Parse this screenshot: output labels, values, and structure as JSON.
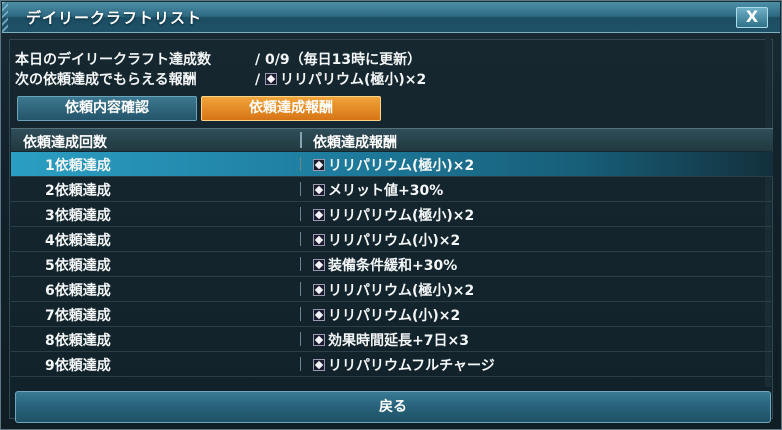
{
  "window": {
    "title": "デイリークラフトリスト",
    "close_label": "X"
  },
  "info": {
    "achieved_label": "本日のデイリークラフト達成数",
    "achieved_value": "/ 0/9（毎日13時に更新）",
    "next_reward_label": "次の依頼達成でもらえる報酬",
    "next_reward_value": "リリパリウム(極小)×2"
  },
  "tabs": [
    {
      "label": "依頼内容確認",
      "active": false
    },
    {
      "label": "依頼達成報酬",
      "active": true
    }
  ],
  "table": {
    "headers": [
      "依頼達成回数",
      "依頼達成報酬"
    ],
    "rows": [
      {
        "count": "1依頼達成",
        "reward": "リリパリウム(極小)×2",
        "selected": true
      },
      {
        "count": "2依頼達成",
        "reward": "メリット値+30%",
        "selected": false
      },
      {
        "count": "3依頼達成",
        "reward": "リリパリウム(極小)×2",
        "selected": false
      },
      {
        "count": "4依頼達成",
        "reward": "リリパリウム(小)×2",
        "selected": false
      },
      {
        "count": "5依頼達成",
        "reward": "装備条件緩和+30%",
        "selected": false
      },
      {
        "count": "6依頼達成",
        "reward": "リリパリウム(極小)×2",
        "selected": false
      },
      {
        "count": "7依頼達成",
        "reward": "リリパリウム(小)×2",
        "selected": false
      },
      {
        "count": "8依頼達成",
        "reward": "効果時間延長+7日×3",
        "selected": false
      },
      {
        "count": "9依頼達成",
        "reward": "リリパリウムフルチャージ",
        "selected": false
      }
    ]
  },
  "footer": {
    "back_label": "戻る"
  },
  "colors": {
    "titlebar": "#2d6880",
    "active_tab": "#e88a24",
    "selected_row": "#2b9ec3"
  }
}
